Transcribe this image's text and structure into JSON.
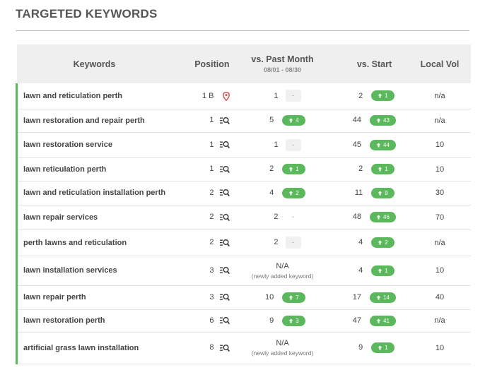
{
  "page_title": "TARGETED KEYWORDS",
  "colors": {
    "accent_green": "#5cb85c",
    "pin_red": "#d9534f"
  },
  "headers": {
    "keywords": "Keywords",
    "position": "Position",
    "past_month": "vs. Past Month",
    "past_month_range": "08/01 - 08/30",
    "start": "vs. Start",
    "local_vol": "Local Vol"
  },
  "rows": [
    {
      "keyword": "lawn and reticulation perth",
      "position": "1 B",
      "position_icon": "map-pin-icon",
      "month": "1",
      "month_change": "-",
      "month_type": "dash",
      "start": "2",
      "start_change": "1",
      "local_vol": "n/a"
    },
    {
      "keyword": "lawn restoration and repair perth",
      "position": "1",
      "position_icon": "search-list-icon",
      "month": "5",
      "month_change": "4",
      "month_type": "up",
      "start": "44",
      "start_change": "43",
      "local_vol": "n/a"
    },
    {
      "keyword": "lawn restoration service",
      "position": "1",
      "position_icon": "search-list-icon",
      "month": "1",
      "month_change": "-",
      "month_type": "dash",
      "start": "45",
      "start_change": "44",
      "local_vol": "10"
    },
    {
      "keyword": "lawn reticulation perth",
      "position": "1",
      "position_icon": "search-list-icon",
      "month": "2",
      "month_change": "1",
      "month_type": "up",
      "start": "2",
      "start_change": "1",
      "local_vol": "10"
    },
    {
      "keyword": "lawn and reticulation installation perth",
      "position": "2",
      "position_icon": "search-list-icon",
      "month": "4",
      "month_change": "2",
      "month_type": "up",
      "start": "11",
      "start_change": "9",
      "local_vol": "30"
    },
    {
      "keyword": "lawn repair services",
      "position": "2",
      "position_icon": "search-list-icon",
      "month": "2",
      "month_change": "-",
      "month_type": "dash-plain",
      "start": "48",
      "start_change": "46",
      "local_vol": "70"
    },
    {
      "keyword": "perth lawns and reticulation",
      "position": "2",
      "position_icon": "search-list-icon",
      "month": "2",
      "month_change": "-",
      "month_type": "dash",
      "start": "4",
      "start_change": "2",
      "local_vol": "n/a"
    },
    {
      "keyword": "lawn installation services",
      "position": "3",
      "position_icon": "search-list-icon",
      "month": "N/A",
      "month_note": "(newly added keyword)",
      "month_type": "na",
      "start": "4",
      "start_change": "1",
      "local_vol": "10"
    },
    {
      "keyword": "lawn repair perth",
      "position": "3",
      "position_icon": "search-list-icon",
      "month": "10",
      "month_change": "7",
      "month_type": "up",
      "start": "17",
      "start_change": "14",
      "local_vol": "40"
    },
    {
      "keyword": "lawn restoration perth",
      "position": "6",
      "position_icon": "search-list-icon",
      "month": "9",
      "month_change": "3",
      "month_type": "up",
      "start": "47",
      "start_change": "41",
      "local_vol": "n/a"
    },
    {
      "keyword": "artificial grass lawn installation",
      "position": "8",
      "position_icon": "search-list-icon",
      "month": "N/A",
      "month_note": "(newly added keyword)",
      "month_type": "na",
      "start": "9",
      "start_change": "1",
      "local_vol": "10"
    }
  ]
}
